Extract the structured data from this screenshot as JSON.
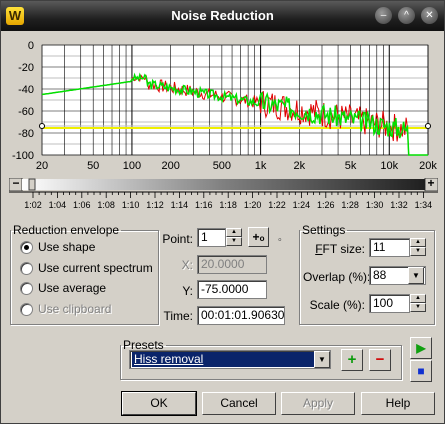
{
  "window": {
    "title": "Noise Reduction",
    "app_icon_letter": "W",
    "controls": [
      "minimize-icon",
      "maximize-icon",
      "close-icon"
    ]
  },
  "graph": {
    "y_tick_labels": [
      "0",
      "-20",
      "-40",
      "-60",
      "-80",
      "-100"
    ],
    "x_tick_labels": [
      "20",
      "50",
      "100",
      "200",
      "500",
      "1k",
      "2k",
      "5k",
      "10k",
      "20k"
    ],
    "background": "#ffffff",
    "grid_color": "#000000",
    "series_colors": {
      "noise_profile_green": "#00e000",
      "spectrum_red": "#e00000",
      "threshold_yellow": "#f0f000",
      "reduction_envelope_gray": "#c0c0c0"
    }
  },
  "zoom_scroll": {
    "minus_label": "−",
    "plus_label": "+"
  },
  "ruler": {
    "labels": [
      "1:02",
      "1:04",
      "1:06",
      "1:08",
      "1:10",
      "1:12",
      "1:14",
      "1:16",
      "1:18",
      "1:20",
      "1:22",
      "1:24",
      "1:26",
      "1:28",
      "1:30",
      "1:32",
      "1:34"
    ]
  },
  "reduction_envelope": {
    "legend": "Reduction envelope",
    "options": [
      {
        "label": "Use shape",
        "selected": true,
        "disabled": false
      },
      {
        "label": "Use current spectrum",
        "selected": false,
        "disabled": false
      },
      {
        "label": "Use average",
        "selected": false,
        "disabled": false
      },
      {
        "label": "Use clipboard",
        "selected": false,
        "disabled": true
      }
    ]
  },
  "point": {
    "point_label": "Point:",
    "point_value": "1",
    "x_label": "X:",
    "x_value": "20.0000",
    "y_label": "Y:",
    "y_value": "-75.0000",
    "time_label": "Time:",
    "time_value": "00:01:01.90630"
  },
  "settings": {
    "legend": "Settings",
    "fft_label_u": "F",
    "fft_label_rest": "FT size:",
    "fft_value": "11",
    "overlap_label": "Overlap (%):",
    "overlap_value": "88",
    "scale_label": "Scale (%):",
    "scale_value": "100"
  },
  "presets": {
    "legend": "Presets",
    "selected": "Hiss removal"
  },
  "buttons": {
    "ok": "OK",
    "cancel": "Cancel",
    "apply": "Apply",
    "help": "Help"
  }
}
